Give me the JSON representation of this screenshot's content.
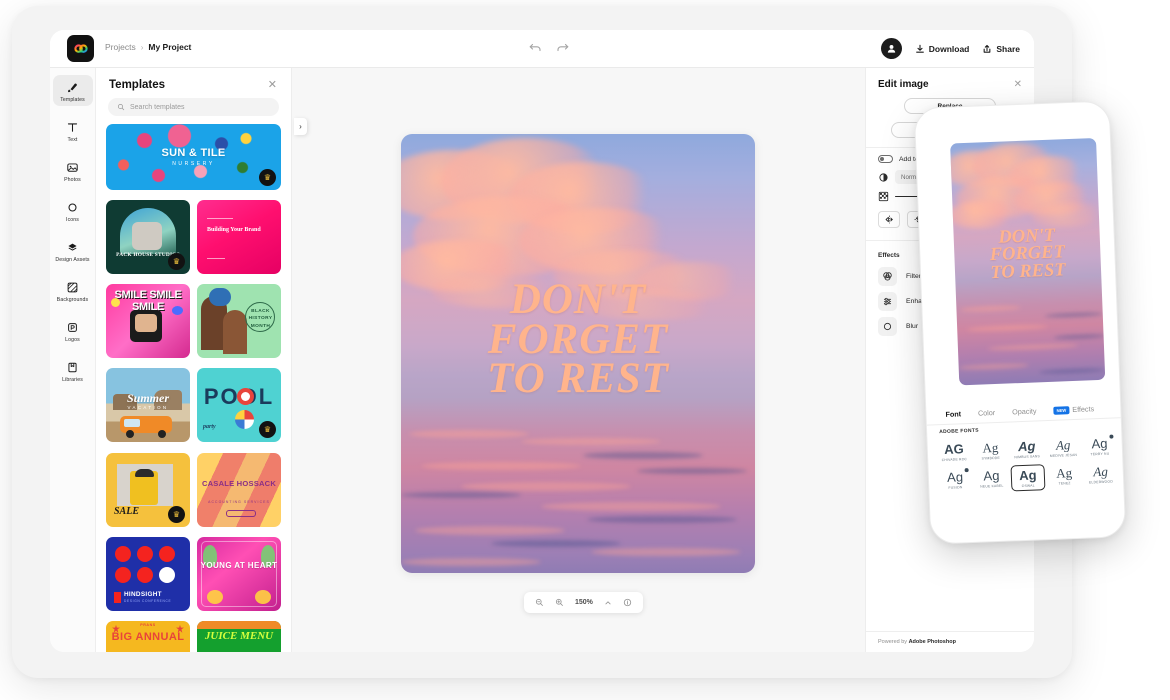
{
  "topbar": {
    "logo_icon": "adobe-express-logo",
    "breadcrumb_root": "Projects",
    "breadcrumb_sep": "›",
    "breadcrumb_current": "My Project",
    "undo_icon": "undo-icon",
    "redo_icon": "redo-icon",
    "avatar_icon": "user-avatar",
    "download_label": "Download",
    "download_icon": "download-icon",
    "share_label": "Share",
    "share_icon": "share-icon"
  },
  "rail": {
    "items": [
      {
        "label": "Templates",
        "icon": "templates-icon",
        "active": true
      },
      {
        "label": "Text",
        "icon": "text-icon",
        "active": false
      },
      {
        "label": "Photos",
        "icon": "photos-icon",
        "active": false
      },
      {
        "label": "Icons",
        "icon": "icons-icon",
        "active": false
      },
      {
        "label": "Design Assets",
        "icon": "design-assets-icon",
        "active": false
      },
      {
        "label": "Backgrounds",
        "icon": "backgrounds-icon",
        "active": false
      },
      {
        "label": "Logos",
        "icon": "logos-icon",
        "active": false
      },
      {
        "label": "Libraries",
        "icon": "libraries-icon",
        "active": false
      }
    ]
  },
  "panel": {
    "title": "Templates",
    "close_icon": "close-icon",
    "search_placeholder": "Search templates",
    "search_icon": "search-icon",
    "expander_icon": "chevron-right-icon",
    "templates": [
      {
        "text": "SUN & TILE",
        "subtext": "NURSERY",
        "premium": true
      },
      {
        "text": "PACK HOUSE STUDIOS",
        "subtext": "",
        "premium": true
      },
      {
        "text": "Building Your Brand",
        "subtext": "",
        "premium": false
      },
      {
        "text": "SMILE SMILE SMILE",
        "subtext": "",
        "premium": false
      },
      {
        "text": "BLACK HISTORY MONTH",
        "subtext": "",
        "premium": false
      },
      {
        "text": "Summer",
        "subtext": "VACATION",
        "premium": false
      },
      {
        "text": "POOL",
        "subtext": "party",
        "premium": true
      },
      {
        "text": "SALE",
        "subtext": "",
        "premium": true
      },
      {
        "text": "CASALE HOSSACK",
        "subtext": "ACCOUNTING SERVICES",
        "premium": false
      },
      {
        "text": "HINDSIGHT",
        "subtext": "DESIGN CONFERENCE",
        "premium": false
      },
      {
        "text": "YOUNG AT HEART",
        "subtext": "",
        "premium": false
      },
      {
        "text": "BIG ANNUAL",
        "subtext": "",
        "premium": false
      },
      {
        "text": "JUICE MENU",
        "subtext": "",
        "premium": false
      }
    ]
  },
  "canvas": {
    "artwork_line1": "DON'T",
    "artwork_line2": "FORGET",
    "artwork_line3": "TO REST",
    "artwork_text_color": "#ffb48c",
    "object_tools": [
      {
        "icon": "image-icon"
      },
      {
        "icon": "duplicate-icon"
      },
      {
        "icon": "effects-icon"
      },
      {
        "icon": "trash-icon"
      }
    ],
    "zoom": {
      "zoom_out_icon": "zoom-out-icon",
      "zoom_in_icon": "zoom-in-icon",
      "level": "150%",
      "chevron_icon": "chevron-up-icon",
      "info_icon": "info-icon"
    }
  },
  "edit_panel": {
    "title": "Edit image",
    "close_icon": "close-icon",
    "replace_label": "Replace",
    "remove_background_label": "Remove background",
    "add_to_background_label": "Add to background",
    "blend_mode_value": "Normal",
    "blend_icon": "blend-mode-icon",
    "opacity_icon": "opacity-icon",
    "flip_horizontal_icon": "flip-horizontal-icon",
    "flip_vertical_icon": "flip-vertical-icon",
    "crop_icon": "crop-icon",
    "effects_title": "Effects",
    "effects": [
      {
        "label": "Filters",
        "icon": "filters-icon"
      },
      {
        "label": "Enhancements",
        "icon": "enhancements-icon"
      },
      {
        "label": "Blur",
        "icon": "blur-icon"
      }
    ],
    "powered_prefix": "Powered by ",
    "powered_brand": "Adobe Photoshop"
  },
  "phone": {
    "artwork_line1": "DON'T",
    "artwork_line2": "FORGET",
    "artwork_line3": "TO REST",
    "tabs": [
      {
        "label": "Font",
        "active": true,
        "badge": ""
      },
      {
        "label": "Color",
        "active": false,
        "badge": ""
      },
      {
        "label": "Opacity",
        "active": false,
        "badge": ""
      },
      {
        "label": "Effects",
        "active": false,
        "badge": "NEW"
      }
    ],
    "section_label": "ADOBE FONTS",
    "font_sample": "Ag",
    "fonts": [
      {
        "sample": "AG",
        "name": "CHIVADE ROC",
        "selected": false,
        "premium": false
      },
      {
        "sample": "Ag",
        "name": "SYMBODE",
        "selected": false,
        "premium": false
      },
      {
        "sample": "Ag",
        "name": "NIMBUS SANS",
        "selected": false,
        "premium": false
      },
      {
        "sample": "Ag",
        "name": "MEDIVE JESAN",
        "selected": false,
        "premium": false
      },
      {
        "sample": "Ag",
        "name": "TERRY NU",
        "selected": false,
        "premium": true
      },
      {
        "sample": "Ag",
        "name": "FUSION",
        "selected": false,
        "premium": true
      },
      {
        "sample": "Ag",
        "name": "NEUE KABEL",
        "selected": false,
        "premium": false
      },
      {
        "sample": "Ag",
        "name": "OSWAL",
        "selected": true,
        "premium": false
      },
      {
        "sample": "Ag",
        "name": "TENEZ",
        "selected": false,
        "premium": false
      },
      {
        "sample": "Ag",
        "name": "ELDERWOOD",
        "selected": false,
        "premium": false
      }
    ]
  }
}
